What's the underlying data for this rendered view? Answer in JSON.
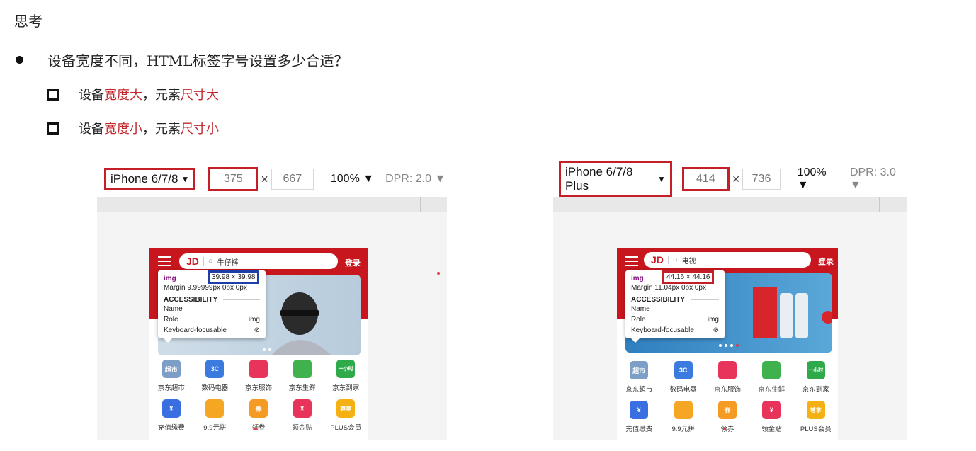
{
  "heading": "思考",
  "question": "设备宽度不同，HTML标签字号设置多少合适？",
  "points": [
    {
      "prefix": "设备",
      "hl1": "宽度大",
      "mid": "，元素",
      "hl2": "尺寸大"
    },
    {
      "prefix": "设备",
      "hl1": "宽度小",
      "mid": "，元素",
      "hl2": "尺寸小"
    }
  ],
  "colors": {
    "accent": "#c0282e",
    "jd_red": "#c8161e",
    "highlight_box": "#c41e28",
    "img_box_left": "#1f3fa8"
  },
  "left_panel": {
    "device": "iPhone 6/7/8",
    "width": "375",
    "times": "×",
    "height": "667",
    "zoom": "100%",
    "dpr": "DPR: 2.0",
    "search_text": "牛仔裤",
    "login": "登录",
    "logo": "JD",
    "tooltip": {
      "tag": "img",
      "size": "39.98 × 39.98",
      "margin": "Margin  9.99999px 0px 0px",
      "accessibility": "ACCESSIBILITY",
      "name_label": "Name",
      "role_label": "Role",
      "role_value": "img",
      "kbd_label": "Keyboard-focusable"
    }
  },
  "right_panel": {
    "device": "iPhone 6/7/8 Plus",
    "width": "414",
    "times": "×",
    "height": "736",
    "zoom": "100%",
    "dpr": "DPR: 3.0",
    "search_text": "电视",
    "login": "登录",
    "logo": "JD",
    "tooltip": {
      "tag": "img",
      "size": "44.16 × 44.16",
      "margin": "Margin  11.04px 0px 0px",
      "accessibility": "ACCESSIBILITY",
      "name_label": "Name",
      "role_label": "Role",
      "role_value": "img",
      "kbd_label": "Keyboard-focusable"
    }
  },
  "nav_items": [
    {
      "label": "京东超市",
      "icon": "超市",
      "color": "#7d9fc7"
    },
    {
      "label": "数码电器",
      "icon": "3C",
      "color": "#3b7be0"
    },
    {
      "label": "京东服饰",
      "icon": "",
      "color": "#e8335a"
    },
    {
      "label": "京东生鲜",
      "icon": "",
      "color": "#3fb24d"
    },
    {
      "label": "京东到家",
      "icon": "一小时",
      "color": "#2faa4a"
    },
    {
      "label": "充值缴费",
      "icon": "¥",
      "color": "#3a6fe2"
    },
    {
      "label": "9.9元拼",
      "icon": "",
      "color": "#f5a623"
    },
    {
      "label": "领券",
      "icon": "券",
      "color": "#f59a23"
    },
    {
      "label": "领金贴",
      "icon": "¥",
      "color": "#e8335a"
    },
    {
      "label": "PLUS会员",
      "icon": "尊享",
      "color": "#f5b014"
    }
  ]
}
